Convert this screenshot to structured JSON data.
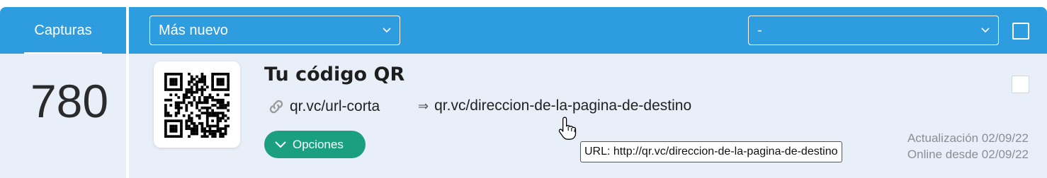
{
  "header": {
    "column_title": "Capturas",
    "sort_select": {
      "value": "Más nuevo",
      "icon": "chevron-down-icon"
    },
    "filter_select": {
      "value": "-",
      "icon": "chevron-down-icon"
    },
    "select_all_checked": false
  },
  "row": {
    "scans": "780",
    "title": "Tu código QR",
    "short_url": "qr.vc/url-corta",
    "arrow": "⇒",
    "destination_url": "qr.vc/direccion-de-la-pagina-de-destino",
    "options_label": "Opciones",
    "updated": "Actualización 02/09/22",
    "online_since": "Online desde 02/09/22",
    "checked": false
  },
  "tooltip": {
    "text": "URL: http://qr.vc/direccion-de-la-pagina-de-destino"
  },
  "colors": {
    "header": "#2e9de0",
    "row_bg": "#e9eff9",
    "options_button": "#1aa081"
  }
}
